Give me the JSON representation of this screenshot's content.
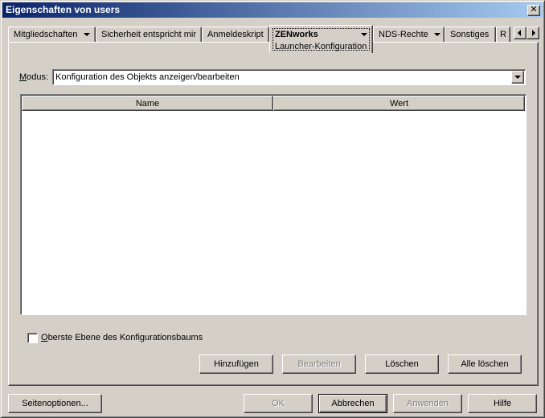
{
  "window": {
    "title": "Eigenschaften von users",
    "close_glyph": "✕"
  },
  "tabs": [
    {
      "label": "Mitgliedschaften",
      "has_dropdown": true
    },
    {
      "label": "Sicherheit entspricht mir",
      "has_dropdown": false
    },
    {
      "label": "Anmeldeskript",
      "has_dropdown": false
    },
    {
      "label": "ZENworks",
      "sublabel": "Launcher-Konfiguration",
      "has_dropdown": true,
      "active": true
    },
    {
      "label": "NDS-Rechte",
      "has_dropdown": true
    },
    {
      "label": "Sonstiges",
      "has_dropdown": false
    },
    {
      "label": "R",
      "has_dropdown": false
    }
  ],
  "modus": {
    "label_prefix": "M",
    "label_rest": "odus:",
    "value": "Konfiguration des Objekts anzeigen/bearbeiten"
  },
  "table": {
    "columns": [
      "Name",
      "Wert"
    ],
    "rows": []
  },
  "checkbox": {
    "label_prefix": "O",
    "label_rest": "berste Ebene des Konfigurationsbaums",
    "checked": false
  },
  "actions": {
    "add": "Hinzufügen",
    "edit": "Bearbeiten",
    "delete": "Löschen",
    "delete_all": "Alle löschen"
  },
  "footer": {
    "page_options": "Seitenoptionen...",
    "ok": "OK",
    "cancel": "Abbrechen",
    "apply": "Anwenden",
    "help": "Hilfe"
  }
}
